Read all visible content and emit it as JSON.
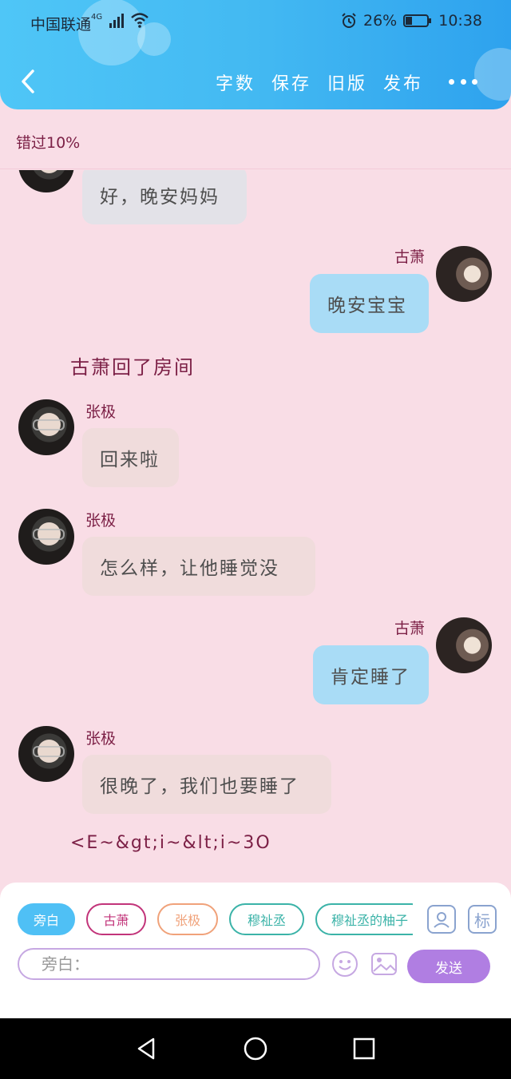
{
  "status_bar": {
    "carrier": "中国联通",
    "network": "4G",
    "battery": "26%",
    "time": "10:38"
  },
  "header": {
    "actions": [
      "字数",
      "保存",
      "旧版",
      "发布"
    ]
  },
  "miss_bar": {
    "text": "错过10%"
  },
  "chat": {
    "messages": [
      {
        "text": "好，晚安妈妈"
      },
      {
        "name": "古萧",
        "text": "晚安宝宝"
      },
      {
        "narration": "古萧回了房间"
      },
      {
        "name": "张极",
        "text": "回来啦"
      },
      {
        "name": "张极",
        "text": "怎么样，让他睡觉没"
      },
      {
        "name": "古萧",
        "text": "肯定睡了"
      },
      {
        "name": "张极",
        "text": "很晚了，我们也要睡了"
      },
      {
        "narration": "<E~&gt;i~&lt;i~3O"
      }
    ]
  },
  "panel": {
    "roles": [
      "旁白",
      "古萧",
      "张极",
      "穆祉丞",
      "穆祉丞的柚子"
    ],
    "tool_right_label": "标",
    "input_placeholder": "旁白：",
    "send_label": "发送"
  },
  "colors": {
    "header_blue": "#43b9f2",
    "background_pink": "#f9dde6",
    "name_color": "#7c2046",
    "send_purple": "#b07ee2"
  }
}
